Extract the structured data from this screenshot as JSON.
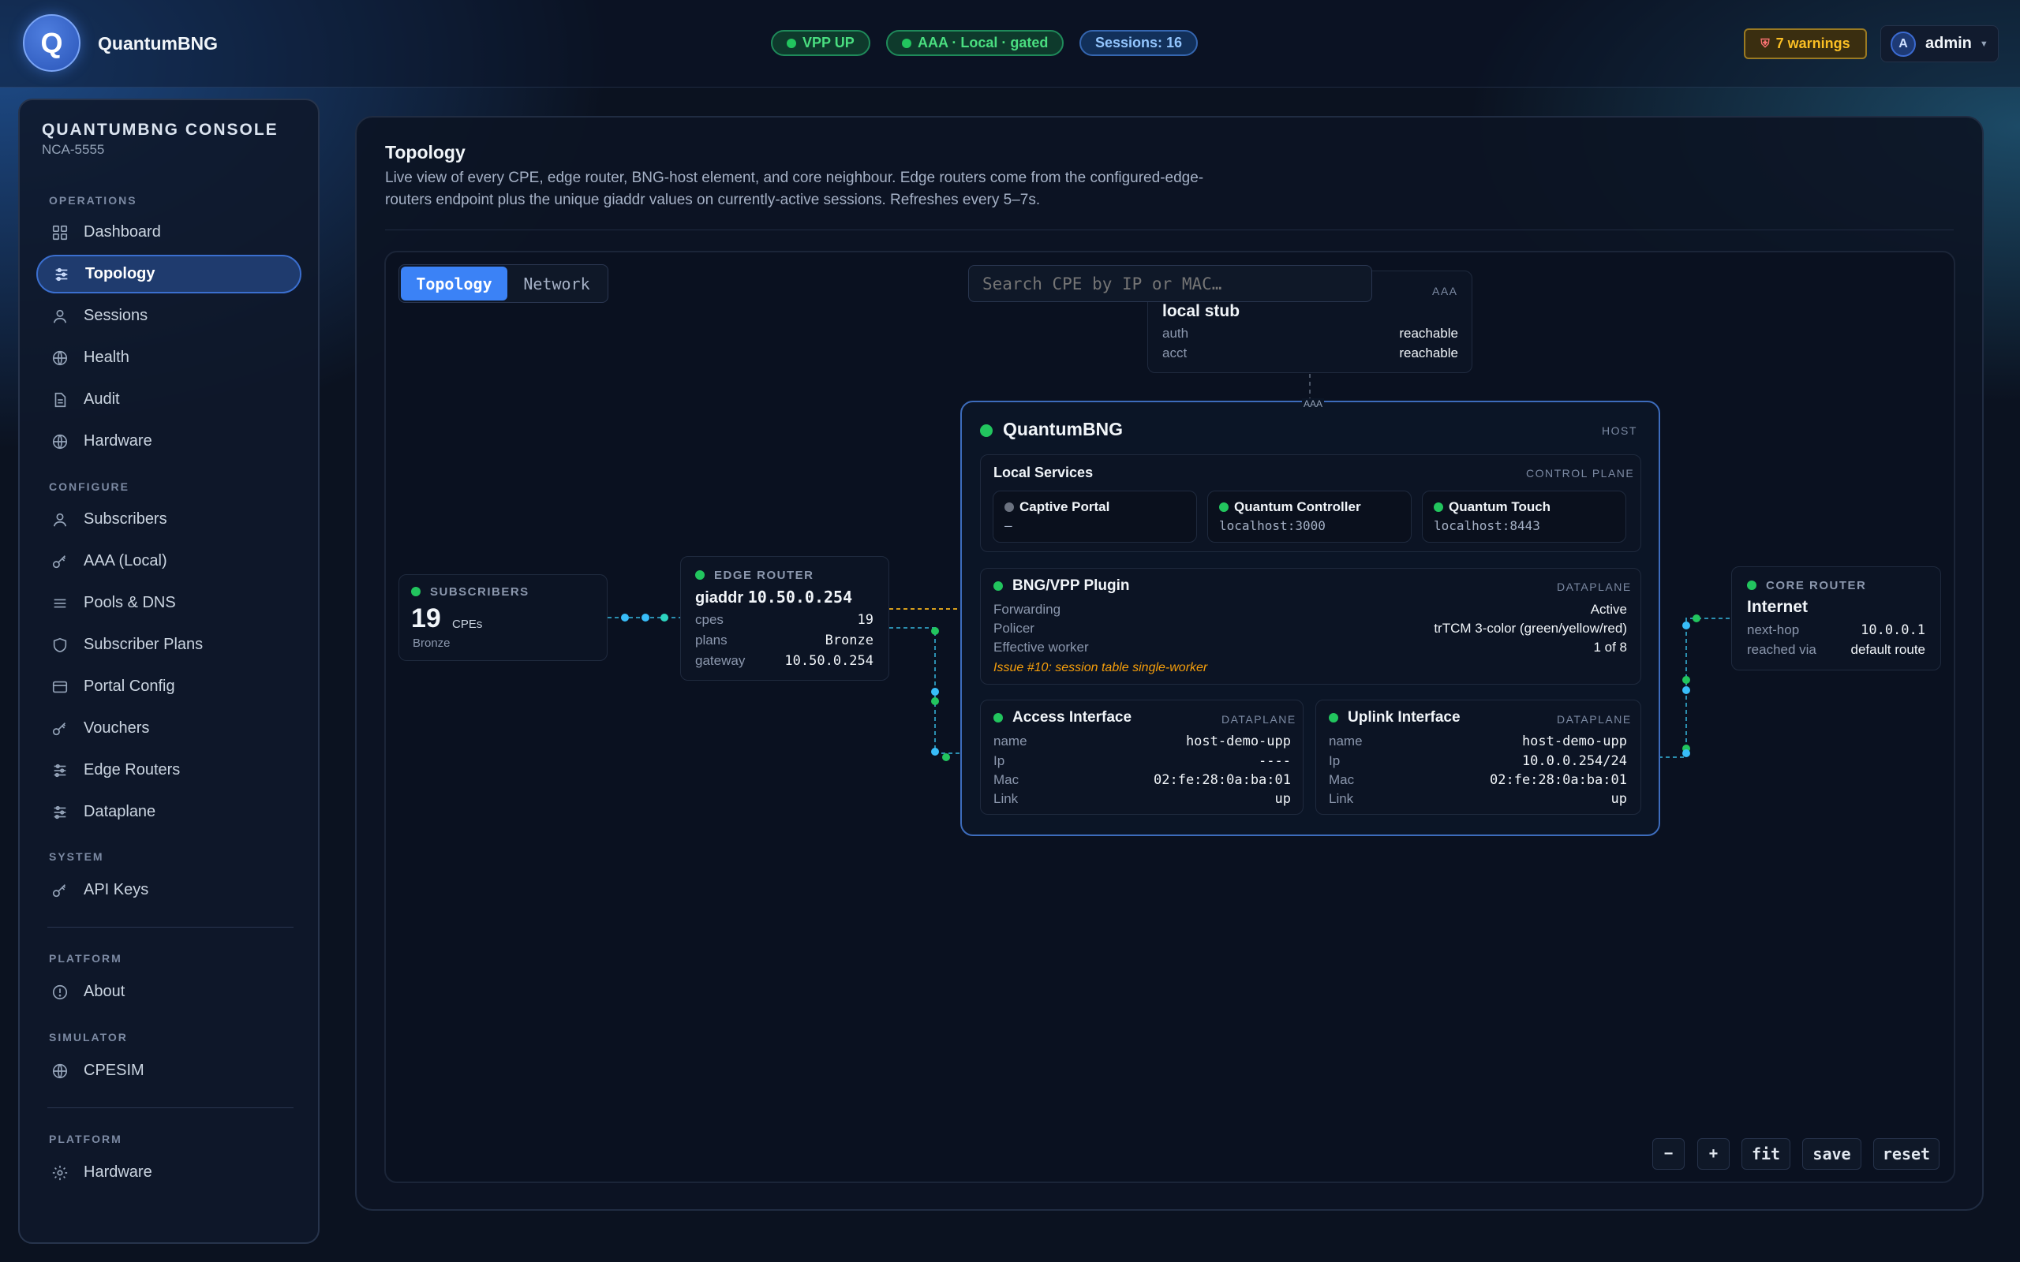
{
  "header": {
    "logo_letter": "Q",
    "brand": "QuantumBNG",
    "status_vpp": "VPP UP",
    "status_aaa": "AAA · Local · gated",
    "sessions": "Sessions: 16",
    "warnings": "7 warnings",
    "user_initial": "A",
    "user_name": "admin"
  },
  "sidebar": {
    "title": "QUANTUMBNG CONSOLE",
    "subtitle": "NCA-5555",
    "sections": {
      "operations": "OPERATIONS",
      "configure": "CONFIGURE",
      "system": "SYSTEM",
      "platform": "PLATFORM",
      "simulator": "SIMULATOR",
      "platform2": "PLATFORM"
    },
    "items": {
      "dashboard": "Dashboard",
      "topology": "Topology",
      "sessions": "Sessions",
      "health": "Health",
      "audit": "Audit",
      "hardware": "Hardware",
      "subscribers": "Subscribers",
      "aaa_local": "AAA (Local)",
      "pools_dns": "Pools & DNS",
      "subscriber_plans": "Subscriber Plans",
      "portal_config": "Portal Config",
      "vouchers": "Vouchers",
      "edge_routers": "Edge Routers",
      "dataplane": "Dataplane",
      "api_keys": "API Keys",
      "about": "About",
      "cpesim": "CPESIM",
      "hardware2": "Hardware"
    }
  },
  "page": {
    "title": "Topology",
    "description": "Live view of every CPE, edge router, BNG-host element, and core neighbour. Edge routers come from the configured-edge-routers endpoint plus the unique giaddr values on currently-active sessions. Refreshes every 5–7s."
  },
  "canvas": {
    "tabs": [
      "Topology",
      "Network"
    ],
    "search_placeholder": "Search CPE by IP or MAC…",
    "controls": {
      "zoom_out": "−",
      "zoom_in": "+",
      "fit": "fit",
      "save": "save",
      "reset": "reset"
    }
  },
  "aaa_card": {
    "tag": "AAA",
    "title": "local stub",
    "rows": [
      {
        "k": "auth",
        "v": "reachable"
      },
      {
        "k": "acct",
        "v": "reachable"
      }
    ],
    "edge_label": "AAA"
  },
  "subscribers_card": {
    "label": "SUBSCRIBERS",
    "count": "19",
    "unit": "CPEs",
    "plan": "Bronze"
  },
  "edge_card": {
    "label": "EDGE ROUTER",
    "title_key": "giaddr",
    "title_val": "10.50.0.254",
    "rows": [
      {
        "k": "cpes",
        "v": "19"
      },
      {
        "k": "plans",
        "v": "Bronze"
      },
      {
        "k": "gateway",
        "v": "10.50.0.254"
      }
    ]
  },
  "host": {
    "title": "QuantumBNG",
    "tag": "HOST",
    "local_services": {
      "title": "Local Services",
      "tag": "CONTROL PLANE",
      "services": [
        {
          "name": "Captive Portal",
          "addr": "—"
        },
        {
          "name": "Quantum Controller",
          "addr": "localhost:3000"
        },
        {
          "name": "Quantum Touch",
          "addr": "localhost:8443"
        }
      ]
    },
    "plugin": {
      "title": "BNG/VPP Plugin",
      "tag": "DATAPLANE",
      "rows": [
        {
          "k": "Forwarding",
          "v": "Active"
        },
        {
          "k": "Policer",
          "v": "trTCM 3-color (green/yellow/red)"
        },
        {
          "k": "Effective worker",
          "v": "1 of 8"
        }
      ],
      "issue": "Issue #10: session table single-worker"
    },
    "access": {
      "title": "Access Interface",
      "tag": "DATAPLANE",
      "rows": [
        {
          "k": "name",
          "v": "host-demo-upp"
        },
        {
          "k": "Ip",
          "v": "----"
        },
        {
          "k": "Mac",
          "v": "02:fe:28:0a:ba:01"
        },
        {
          "k": "Link",
          "v": "up"
        }
      ]
    },
    "uplink": {
      "title": "Uplink Interface",
      "tag": "DATAPLANE",
      "rows": [
        {
          "k": "name",
          "v": "host-demo-upp"
        },
        {
          "k": "Ip",
          "v": "10.0.0.254/24"
        },
        {
          "k": "Mac",
          "v": "02:fe:28:0a:ba:01"
        },
        {
          "k": "Link",
          "v": "up"
        }
      ]
    }
  },
  "core_card": {
    "label": "CORE ROUTER",
    "title": "Internet",
    "rows": [
      {
        "k": "next-hop",
        "v": "10.0.0.1"
      },
      {
        "k": "reached via",
        "v": "default route"
      }
    ]
  },
  "colors": {
    "accent": "#3b82f6",
    "ok": "#22c55e",
    "warn": "#fbbf24",
    "issue": "#f59e0b"
  }
}
